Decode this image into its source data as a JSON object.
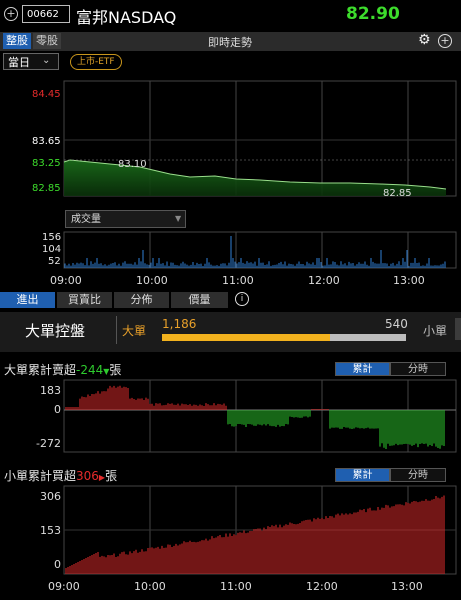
{
  "header": {
    "code": "00662",
    "name": "富邦NASDAQ",
    "price": "82.90"
  },
  "tabbar": {
    "tabs": [
      "整股",
      "零股"
    ],
    "title": "即時走勢"
  },
  "day_selector": {
    "value": "當日"
  },
  "etf_badge": "上市-ETF",
  "price_chart": {
    "y_ticks": [
      "84.45",
      "83.65",
      "83.25",
      "82.85"
    ],
    "high_label": "83.10",
    "low_label": "82.85"
  },
  "volume_chart": {
    "selector": "成交量",
    "y_ticks": [
      "156",
      "104",
      "52"
    ]
  },
  "time_axis": [
    "09:00",
    "10:00",
    "11:00",
    "12:00",
    "13:00"
  ],
  "section_tabs": [
    "進出",
    "買賣比",
    "分佈",
    "價量"
  ],
  "big_order_control": {
    "title": "大單控盤",
    "big_label": "大單",
    "small_label": "小單",
    "big_value": "1,186",
    "small_value": "540",
    "big_share": 0.687
  },
  "big_panel": {
    "title_prefix": "大單累計賣超",
    "value": "-244",
    "unit": "張",
    "toggle": [
      "累計",
      "分時"
    ],
    "y_ticks": [
      "183",
      "0",
      "-272"
    ]
  },
  "small_panel": {
    "title_prefix": "小單累計買超",
    "value": "306",
    "unit": "張",
    "toggle": [
      "累計",
      "分時"
    ],
    "y_ticks": [
      "306",
      "153",
      "0"
    ]
  },
  "colors": {
    "up": "#e52b2b",
    "down": "#2ecb2e",
    "price": "#3ddc2c",
    "accent": "#1f5fb0",
    "big": "#e8a02a"
  }
}
